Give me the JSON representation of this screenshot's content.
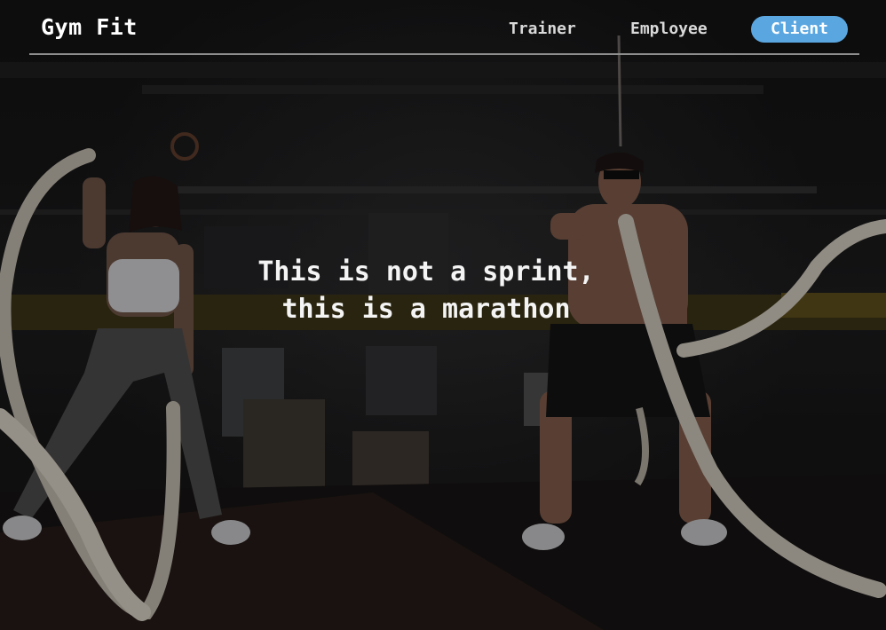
{
  "brand": {
    "name": "Gym Fit"
  },
  "nav": {
    "items": [
      {
        "label": "Trainer",
        "active": false
      },
      {
        "label": "Employee",
        "active": false
      },
      {
        "label": "Client",
        "active": true
      }
    ],
    "active_color": "#5aa6e0"
  },
  "hero": {
    "headline_line1": "This is not a sprint,",
    "headline_line2": "this is a marathon",
    "image_description_icon": "battle-ropes-photo"
  }
}
